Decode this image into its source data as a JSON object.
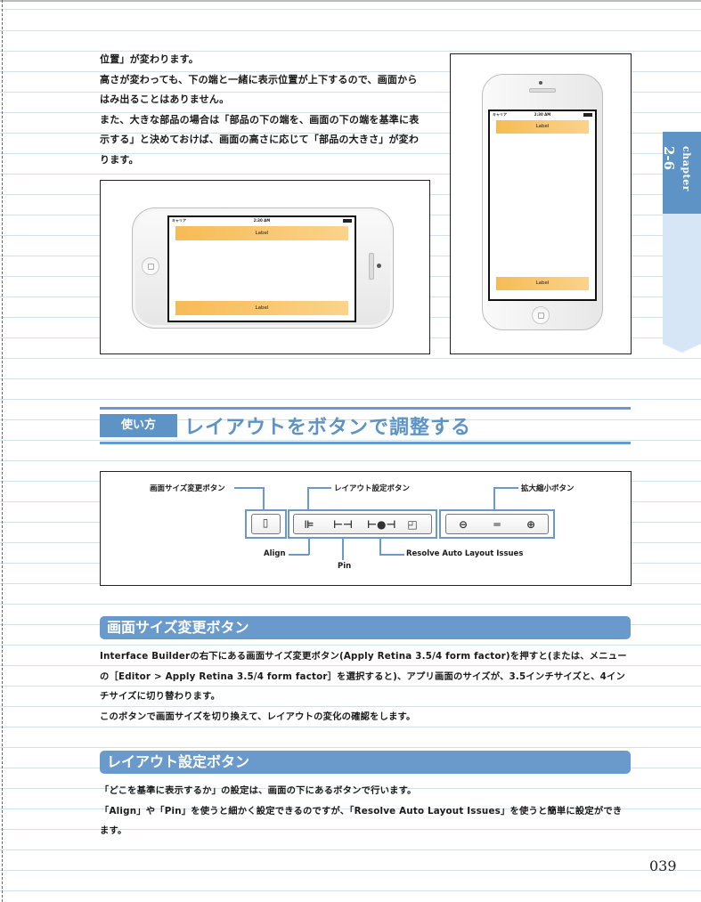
{
  "page_number": "039",
  "chapter": {
    "label": "chapter",
    "number": "2-6"
  },
  "intro_paragraph": [
    "位置」が変わります。",
    "高さが変わっても、下の端と一緒に表示位置が上下するので、画面から",
    "はみ出ることはありません。",
    "また、大きな部品の場合は「部品の下の端を、画面の下の端を基準に表",
    "示する」と決めておけば、画面の高さに応じて「部品の大きさ」が変わ",
    "ります。"
  ],
  "phone_landscape": {
    "carrier": "キャリア",
    "time": "2:30 AM",
    "label_top": "Label",
    "label_bottom": "Label"
  },
  "phone_portrait": {
    "carrier": "キャリア",
    "time": "2:30 AM",
    "label_top": "Label",
    "label_bottom": "Label"
  },
  "section": {
    "badge": "使い方",
    "title": "レイアウトをボタンで調整する"
  },
  "toolbar_figure": {
    "callout_size": "画面サイズ変更ボタン",
    "callout_layout": "レイアウト設定ボタン",
    "callout_zoom": "拡大縮小ボタン",
    "label_align": "Align",
    "label_pin": "Pin",
    "label_resolve": "Resolve Auto Layout Issues",
    "icons": [
      "phone-icon",
      "align-icon",
      "pin-icon",
      "resolve-icon",
      "resize-icon",
      "zoom-out-icon",
      "zoom-fit-icon",
      "zoom-in-icon"
    ]
  },
  "subsection1": {
    "title": "画面サイズ変更ボタン",
    "lines": [
      "Interface Builderの右下にある画面サイズ変更ボタン(Apply Retina 3.5/4 form factor)を押すと(または、メニュー",
      "の［Editor > Apply Retina 3.5/4 form factor］を選択すると)、アプリ画面のサイズが、3.5インチサイズと、4イン",
      "チサイズに切り替わります。",
      "このボタンで画面サイズを切り換えて、レイアウトの変化の確認をします。"
    ]
  },
  "subsection2": {
    "title": "レイアウト設定ボタン",
    "lines": [
      "「どこを基準に表示するか」の設定は、画面の下にあるボタンで行います。",
      "「Align」や「Pin」を使うと細かく設定できるのですが、「Resolve Auto Layout Issues」を使うと簡単に設定ができ",
      "ます。"
    ]
  },
  "colors": {
    "accent": "#5e93c5",
    "label_fill": "#f7bb55",
    "tab_light": "#d6e6f6",
    "ruled_line": "#cfe3ee"
  }
}
